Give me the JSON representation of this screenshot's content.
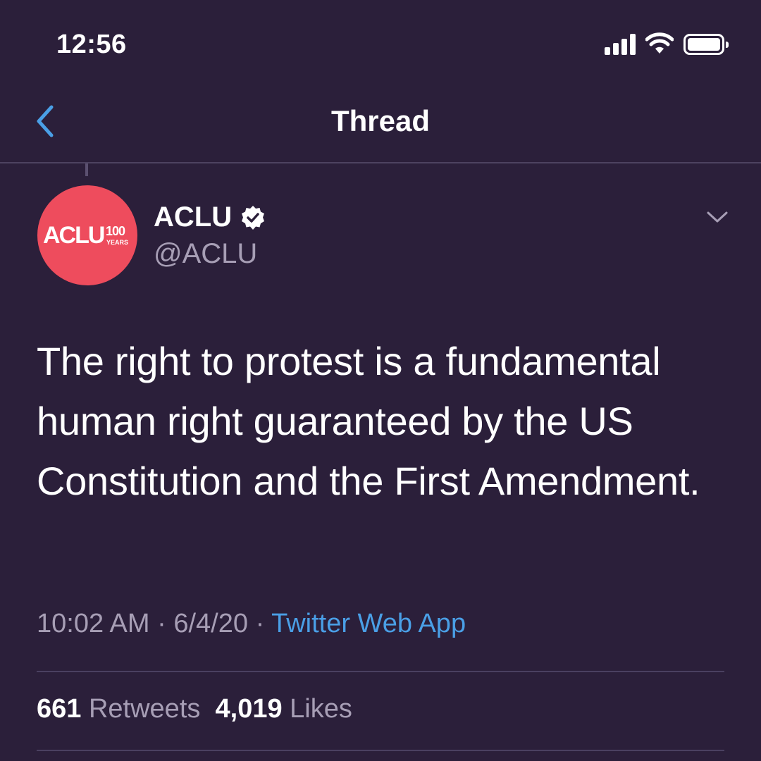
{
  "status_bar": {
    "time": "12:56",
    "icons": [
      "signal-icon",
      "wifi-icon",
      "battery-icon"
    ]
  },
  "nav": {
    "back_icon": "chevron-left-icon",
    "title": "Thread"
  },
  "tweet": {
    "avatar": {
      "logo_text": "ACLU",
      "badge_number": "100",
      "badge_text": "YEARS"
    },
    "author_name": "ACLU",
    "verified_icon": "verified-badge-icon",
    "handle": "@ACLU",
    "more_icon": "chevron-down-icon",
    "text": "The right to protest is a fundamental human right guaranteed by the US Constitution and the First Amendment.",
    "time": "10:02 AM",
    "separator": "·",
    "date": "6/4/20",
    "source": "Twitter Web App",
    "retweets_count": "661",
    "retweets_label": "Retweets",
    "likes_count": "4,019",
    "likes_label": "Likes"
  },
  "colors": {
    "background": "#2b1f3a",
    "accent": "#4a9fe6",
    "avatar": "#ee4c5d",
    "secondary_text": "#a79eb5"
  }
}
